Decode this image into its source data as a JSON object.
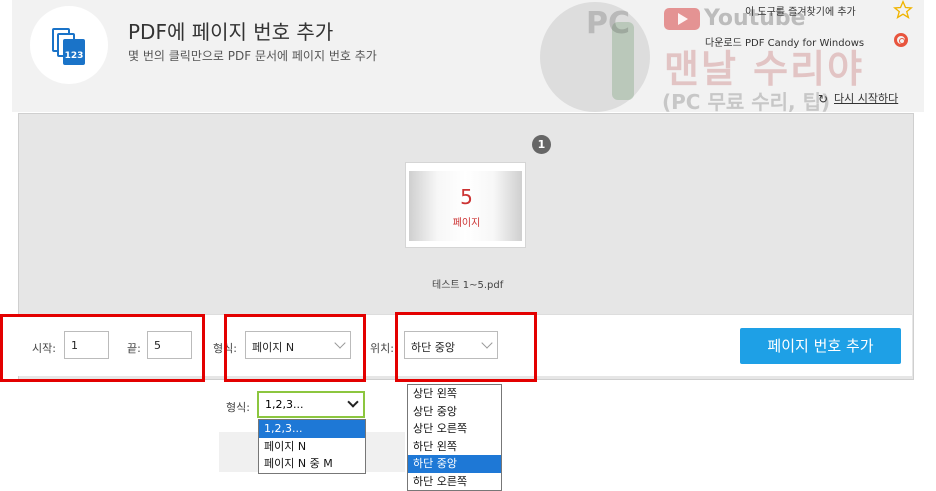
{
  "header": {
    "title": "PDF에 페이지 번호 추가",
    "subtitle": "몇 번의 클릭만으로 PDF 문서에 페이지 번호 추가",
    "logo_text": "123",
    "bookmark_link": "이 도구를 즐겨찾기에 추가",
    "download_link": "다운로드 PDF Candy for Windows",
    "restart_link": "다시 시작하다",
    "restart_icon": "↻"
  },
  "watermark": {
    "pc": "PC",
    "youtube": "Youtube",
    "title": "맨날 수리야",
    "subtitle": "(PC 무료 수리, 팁)"
  },
  "file": {
    "badge": "1",
    "thumb_number": "5",
    "thumb_label": "페이지",
    "filename": "테스트 1~5.pdf"
  },
  "controls": {
    "start_label": "시작:",
    "start_value": "1",
    "end_label": "끝:",
    "end_value": "5",
    "format_label": "형식:",
    "format_value": "페이지 N",
    "position_label": "위치:",
    "position_value": "하단 중앙",
    "add_button": "페이지 번호 추가"
  },
  "format_dropdown": {
    "label": "형식:",
    "value": "1,2,3...",
    "options": [
      "1,2,3...",
      "페이지 N",
      "페이지 N 중 M"
    ],
    "selected_index": 0
  },
  "position_dropdown": {
    "options": [
      "상단 왼쪽",
      "상단 중앙",
      "상단 오른쪽",
      "하단 왼쪽",
      "하단 중앙",
      "하단 오른쪽"
    ],
    "selected_index": 4
  },
  "colors": {
    "accent": "#1ea0e6",
    "highlight": "#e30000",
    "selected_option": "#1e78d6",
    "focus_border": "#8cc63f"
  }
}
